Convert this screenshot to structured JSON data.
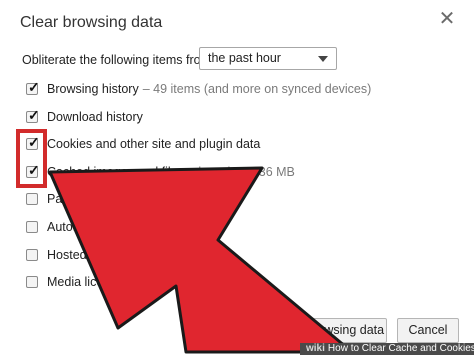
{
  "dialog": {
    "title": "Clear browsing data",
    "close_icon": "close-icon",
    "obliterate_label": "Obliterate the following items from:",
    "time_range": "the past hour"
  },
  "options": [
    {
      "label": "Browsing history",
      "detail": "– 49 items (and more on synced devices)",
      "checked": true
    },
    {
      "label": "Download history",
      "detail": "",
      "checked": true
    },
    {
      "label": "Cookies and other site and plugin data",
      "detail": "",
      "checked": true
    },
    {
      "label": "Cached images and files",
      "detail": "– less than 336 MB",
      "checked": true
    },
    {
      "label": "Pas",
      "detail": "",
      "checked": false
    },
    {
      "label": "Autofil",
      "detail": "",
      "checked": false
    },
    {
      "label": "Hosted app",
      "detail": "",
      "checked": false
    },
    {
      "label": "Media licenses",
      "detail": "",
      "checked": false
    }
  ],
  "buttons": {
    "clear": "Clear browsing data",
    "cancel": "Cancel"
  },
  "footer": {
    "brand": "wiki",
    "caption": "How to Clear Cache and Cookies"
  },
  "annotation": {
    "highlight_color": "#d22b2b",
    "arrow_color": "#e0262f"
  }
}
